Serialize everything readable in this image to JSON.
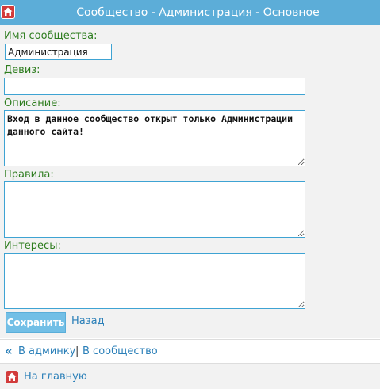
{
  "header": {
    "title": "Сообщество - Администрация - Основное",
    "home_icon": "home-icon",
    "bg_color": "#5cadd8"
  },
  "form": {
    "name": {
      "label": "Имя сообщества:",
      "value": "Администрация"
    },
    "motto": {
      "label": "Девиз:",
      "value": ""
    },
    "description": {
      "label": "Описание:",
      "value": "Вход в данное сообщество открыт только Администрации данного сайта!"
    },
    "rules": {
      "label": "Правила:",
      "value": ""
    },
    "interests": {
      "label": "Интересы:",
      "value": ""
    },
    "save_label": "Сохранить",
    "back_label": "Назад"
  },
  "nav": {
    "arrow_icon": "double-chevron-left-icon",
    "admin_label": "В админку",
    "separator": "|",
    "community_label": "В сообщество"
  },
  "footer": {
    "home_icon": "home-icon",
    "home_label": "На главную"
  },
  "colors": {
    "label_green": "#2e7d1f",
    "link_blue": "#2a7fb8",
    "input_border": "#3ea3d3",
    "button_bg": "#72bfe6",
    "home_red": "#d23b3b"
  }
}
